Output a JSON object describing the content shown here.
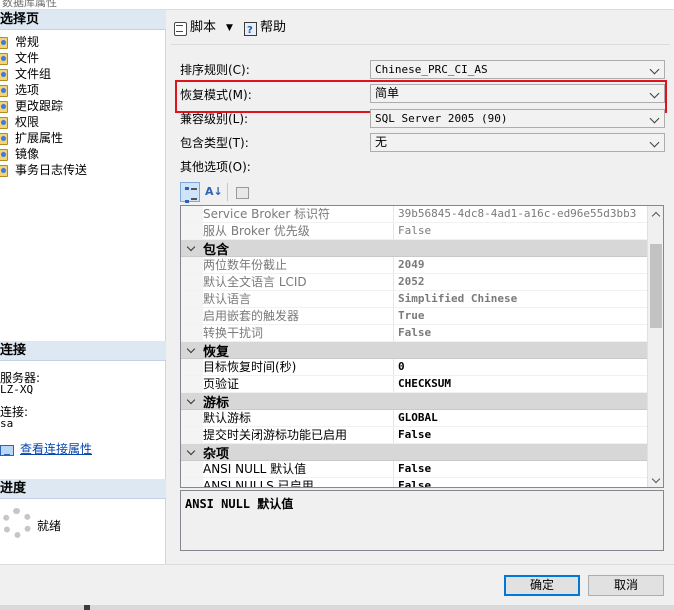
{
  "window": {
    "title": "数据库属性"
  },
  "left": {
    "select_page_header": "选择页",
    "pages": [
      {
        "label": "常规"
      },
      {
        "label": "文件"
      },
      {
        "label": "文件组"
      },
      {
        "label": "选项"
      },
      {
        "label": "更改跟踪"
      },
      {
        "label": "权限"
      },
      {
        "label": "扩展属性"
      },
      {
        "label": "镜像"
      },
      {
        "label": "事务日志传送"
      }
    ],
    "connection_header": "连接",
    "server_label": "服务器:",
    "server_value": "LZ-XQ",
    "connection_label": "连接:",
    "connection_value": "sa",
    "view_connection_link": "查看连接属性",
    "progress_header": "进度",
    "progress_status": "就绪"
  },
  "toolbar": {
    "script_label": "脚本",
    "help_label": "帮助"
  },
  "fields": {
    "collation": {
      "label": "排序规则(C):",
      "value": "Chinese_PRC_CI_AS"
    },
    "recovery_model": {
      "label": "恢复模式(M):",
      "value": "简单"
    },
    "compat_level": {
      "label": "兼容级别(L):",
      "value": "SQL Server 2005 (90)"
    },
    "containment": {
      "label": "包含类型(T):",
      "value": "无"
    },
    "other_options_label": "其他选项(O):"
  },
  "grid": {
    "top_rows": [
      {
        "name": "Service Broker 标识符",
        "value": "39b56845-4dc8-4ad1-a16c-ed96e55d3bb3"
      },
      {
        "name": "服从 Broker 优先级",
        "value": "False"
      }
    ],
    "categories": [
      {
        "title": "包含",
        "rows": [
          {
            "name": "两位数年份截止",
            "value": "2049"
          },
          {
            "name": "默认全文语言 LCID",
            "value": "2052"
          },
          {
            "name": "默认语言",
            "value": "Simplified Chinese"
          },
          {
            "name": "启用嵌套的触发器",
            "value": "True"
          },
          {
            "name": "转换干扰词",
            "value": "False"
          }
        ]
      },
      {
        "title": "恢复",
        "rows": [
          {
            "name": "目标恢复时间(秒)",
            "value": "0"
          },
          {
            "name": "页验证",
            "value": "CHECKSUM"
          }
        ]
      },
      {
        "title": "游标",
        "rows": [
          {
            "name": "默认游标",
            "value": "GLOBAL"
          },
          {
            "name": "提交时关闭游标功能已启用",
            "value": "False"
          }
        ]
      },
      {
        "title": "杂项",
        "rows": [
          {
            "name": "ANSI NULL 默认值",
            "value": "False"
          },
          {
            "name": "ANSI NULLS 已启用",
            "value": "False"
          }
        ]
      }
    ]
  },
  "description": {
    "text": "ANSI NULL 默认值"
  },
  "buttons": {
    "ok": "确定",
    "cancel": "取消"
  },
  "colors": {
    "highlight_border": "#e0131d",
    "link": "#0645ad",
    "default_button_border": "#0078d7"
  }
}
